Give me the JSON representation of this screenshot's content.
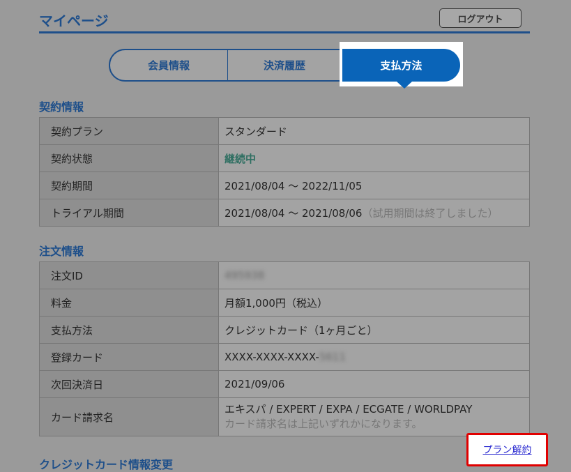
{
  "header": {
    "title": "マイページ",
    "logout_label": "ログアウト"
  },
  "tabs": [
    {
      "label": "会員情報"
    },
    {
      "label": "決済履歴"
    },
    {
      "label": "支払方法",
      "active": true
    }
  ],
  "contract": {
    "heading": "契約情報",
    "rows": [
      {
        "key": "契約プラン",
        "value": "スタンダード"
      },
      {
        "key": "契約状態",
        "value": "継続中"
      },
      {
        "key": "契約期間",
        "value": "2021/08/04 ～ 2022/11/05"
      },
      {
        "key": "トライアル期間",
        "value": "2021/08/04 ～ 2021/08/06",
        "note": "（試用期間は終了しました）"
      }
    ]
  },
  "order": {
    "heading": "注文情報",
    "rows": [
      {
        "key": "注文ID",
        "value": "495938"
      },
      {
        "key": "料金",
        "value": "月額1,000円（税込）"
      },
      {
        "key": "支払方法",
        "value": "クレジットカード（1ヶ月ごと）"
      },
      {
        "key": "登録カード",
        "value": "XXXX-XXXX-XXXX-",
        "masked_tail": "5611"
      },
      {
        "key": "次回決済日",
        "value": "2021/09/06"
      },
      {
        "key": "カード請求名",
        "value": "エキスパ / EXPERT / EXPA / ECGATE / WORLDPAY",
        "note": "カード請求名は上記いずれかになります。"
      }
    ]
  },
  "card_change": {
    "heading": "クレジットカード情報変更"
  },
  "plan_cancel": {
    "label": "プラン解約"
  },
  "colors": {
    "brand_blue": "#1e4f8a",
    "active_tab": "#0a64b8",
    "status_green": "#2f6f62",
    "highlight_red": "#e00000"
  }
}
